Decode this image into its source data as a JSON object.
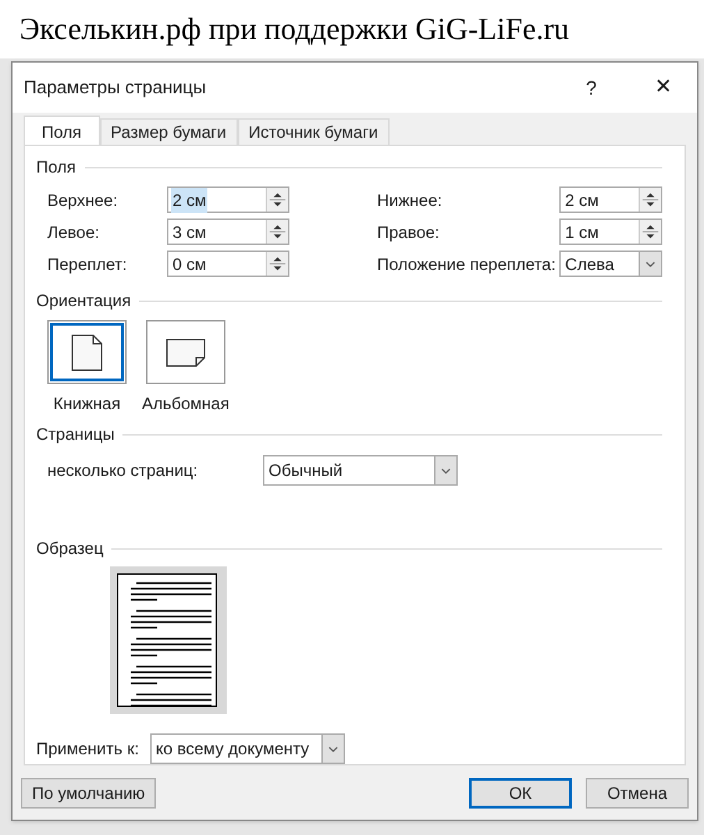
{
  "document": {
    "text": "Экселькин.рф при поддержки GiG-LiFe.ru"
  },
  "window": {
    "title": "Параметры страницы",
    "help": "?",
    "close": "✕"
  },
  "tabs": [
    {
      "label": "Поля",
      "selected": true
    },
    {
      "label": "Размер бумаги",
      "selected": false
    },
    {
      "label": "Источник бумаги",
      "selected": false
    }
  ],
  "margins": {
    "title": "Поля",
    "fields": [
      {
        "label": "Верхнее:",
        "value": "2 см",
        "kind": "spin",
        "highlighted": true
      },
      {
        "label": "Нижнее:",
        "value": "2 см",
        "kind": "spin",
        "highlighted": false
      },
      {
        "label": "Левое:",
        "value": "3 см",
        "kind": "spin",
        "highlighted": false
      },
      {
        "label": "Правое:",
        "value": "1 см",
        "kind": "spin",
        "highlighted": false
      },
      {
        "label": "Переплет:",
        "value": "0 см",
        "kind": "spin",
        "highlighted": false
      },
      {
        "label": "Положение переплета:",
        "value": "Слева",
        "kind": "dropdown",
        "highlighted": false
      }
    ]
  },
  "orientation": {
    "title": "Ориентация",
    "options": [
      {
        "label": "Книжная",
        "kind": "portrait",
        "selected": true
      },
      {
        "label": "Альбомная",
        "kind": "landscape",
        "selected": false
      }
    ]
  },
  "pages": {
    "title": "Страницы",
    "label": "несколько страниц:",
    "value": "Обычный"
  },
  "preview": {
    "title": "Образец"
  },
  "apply": {
    "label": "Применить к:",
    "value": "ко всему документу"
  },
  "buttons": [
    {
      "label": "По умолчанию",
      "default": false
    },
    {
      "label": "ОК",
      "default": true
    },
    {
      "label": "Отмена",
      "default": false
    }
  ]
}
